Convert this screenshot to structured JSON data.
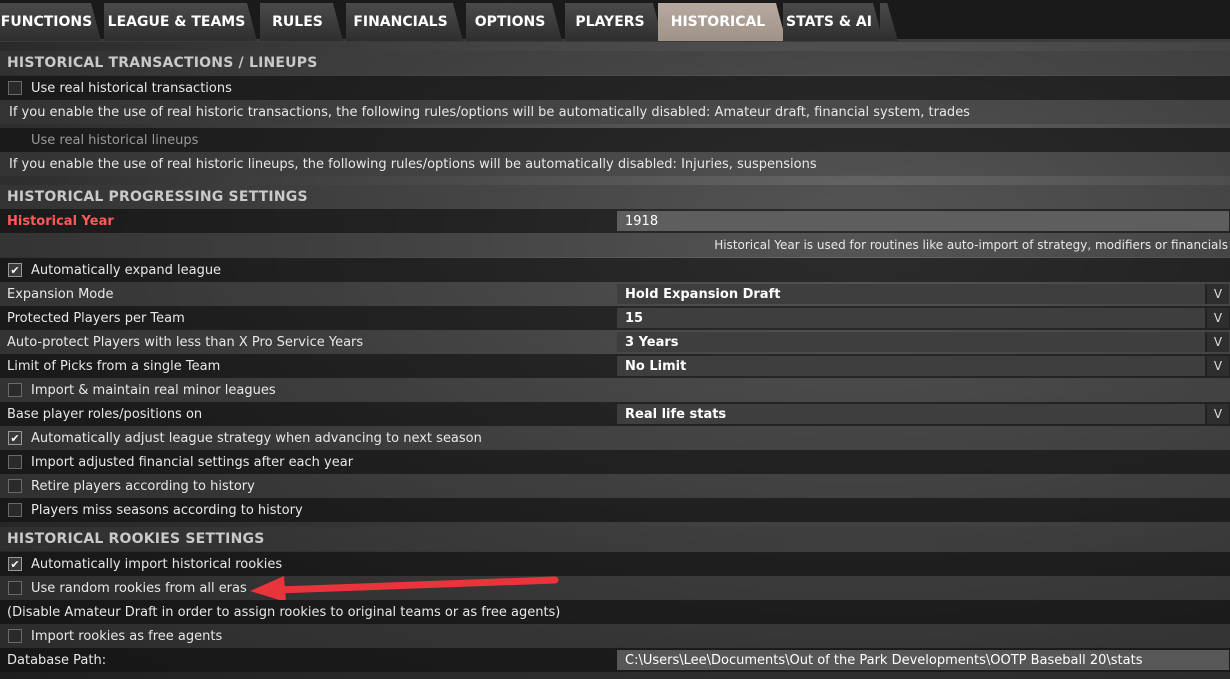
{
  "tabs": [
    {
      "label": "FUNCTIONS",
      "active": false
    },
    {
      "label": "LEAGUE & TEAMS",
      "active": false
    },
    {
      "label": "RULES",
      "active": false
    },
    {
      "label": "FINANCIALS",
      "active": false
    },
    {
      "label": "OPTIONS",
      "active": false
    },
    {
      "label": "PLAYERS",
      "active": false
    },
    {
      "label": "HISTORICAL",
      "active": true
    },
    {
      "label": "STATS & AI",
      "active": false
    }
  ],
  "transactions": {
    "title": "HISTORICAL TRANSACTIONS / LINEUPS",
    "use_real_transactions": {
      "label": "Use real historical transactions",
      "checked": false
    },
    "transactions_note": "If you enable the use of real historic transactions, the following rules/options will be automatically disabled: Amateur draft, financial system, trades",
    "use_real_lineups": {
      "label": "Use real historical lineups",
      "enabled": false
    },
    "lineups_note": "If you enable the use of real historic lineups, the following rules/options will be automatically disabled: Injuries, suspensions"
  },
  "progressing": {
    "title": "HISTORICAL PROGRESSING SETTINGS",
    "historical_year_label": "Historical Year",
    "historical_year_value": "1918",
    "historical_year_help": "Historical Year is used for routines like auto-import of strategy, modifiers or financials",
    "auto_expand": {
      "label": "Automatically expand league",
      "checked": true
    },
    "expansion_mode": {
      "label": "Expansion Mode",
      "value": "Hold Expansion Draft"
    },
    "protected_players": {
      "label": "Protected Players per Team",
      "value": "15"
    },
    "auto_protect": {
      "label": "Auto-protect Players with less than X Pro Service Years",
      "value": "3 Years"
    },
    "limit_picks": {
      "label": "Limit of Picks from a single Team",
      "value": "No Limit"
    },
    "import_minor": {
      "label": "Import & maintain real minor leagues",
      "checked": false
    },
    "base_roles": {
      "label": "Base player roles/positions on",
      "value": "Real life stats"
    },
    "adjust_strategy": {
      "label": "Automatically adjust league strategy when advancing to next season",
      "checked": true
    },
    "import_financial": {
      "label": "Import adjusted financial settings after each year",
      "checked": false
    },
    "retire_players": {
      "label": "Retire players according to history",
      "checked": false
    },
    "miss_seasons": {
      "label": "Players miss seasons according to history",
      "checked": false
    }
  },
  "rookies": {
    "title": "HISTORICAL ROOKIES SETTINGS",
    "auto_import_rookies": {
      "label": "Automatically import historical rookies",
      "checked": true
    },
    "random_rookies": {
      "label": "Use random rookies from all eras",
      "checked": false
    },
    "draft_note": "(Disable Amateur Draft in order to assign rookies to original teams or as free agents)",
    "import_free_agents": {
      "label": "Import rookies as free agents",
      "checked": false
    },
    "database_path_label": "Database Path:",
    "database_path_value": "C:\\Users\\Lee\\Documents\\Out of the Park Developments\\OOTP Baseball 20\\stats"
  },
  "glyphs": {
    "check": "✔",
    "dropdown": "V"
  },
  "colors": {
    "accent_red": "#ff5a5a",
    "active_tab": "#a99c91",
    "annotation_arrow": "#e8343a"
  }
}
